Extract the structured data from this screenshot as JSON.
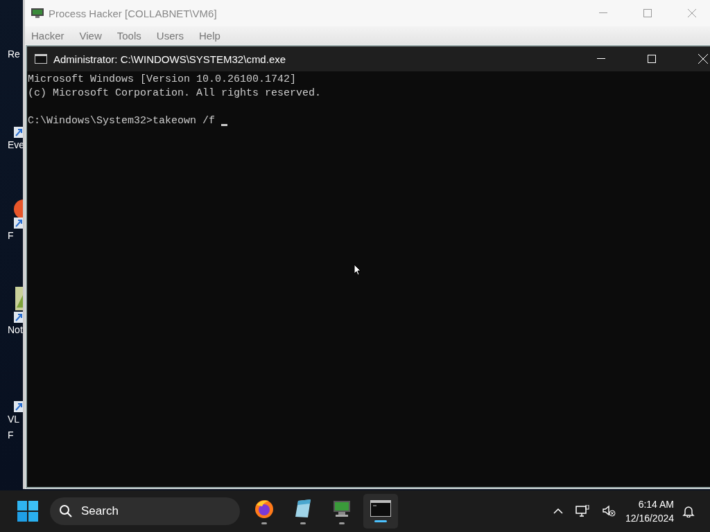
{
  "desktop": {
    "icons": [
      {
        "label": "Re",
        "kind": "bin"
      },
      {
        "label": "Eve",
        "kind": "shortcut"
      },
      {
        "label": "F",
        "kind": "firefox"
      },
      {
        "label": "Not",
        "kind": "notepad"
      },
      {
        "label": "VL",
        "kind": "vlc"
      },
      {
        "label": "F",
        "kind": "text"
      }
    ]
  },
  "process_hacker": {
    "title": "Process Hacker [COLLABNET\\VM6]",
    "menu": [
      "Hacker",
      "View",
      "Tools",
      "Users",
      "Help"
    ]
  },
  "cmd": {
    "title": "Administrator: C:\\WINDOWS\\SYSTEM32\\cmd.exe",
    "lines": [
      "Microsoft Windows [Version 10.0.26100.1742]",
      "(c) Microsoft Corporation. All rights reserved."
    ],
    "prompt": "C:\\Windows\\System32>takeown /f "
  },
  "taskbar": {
    "search": {
      "placeholder": "Search"
    },
    "apps": [
      {
        "kind": "firefox",
        "selected": false
      },
      {
        "kind": "notepad",
        "selected": false
      },
      {
        "kind": "processhacker",
        "selected": false
      },
      {
        "kind": "terminal",
        "selected": true
      }
    ],
    "clock": {
      "time": "6:14 AM",
      "date": "12/16/2024"
    }
  }
}
